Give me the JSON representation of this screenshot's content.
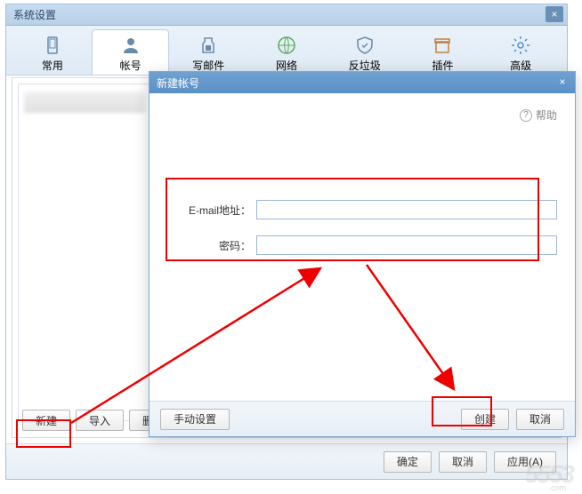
{
  "outer": {
    "title": "系统设置",
    "tabs": [
      {
        "label": "常用"
      },
      {
        "label": "帐号"
      },
      {
        "label": "写邮件"
      },
      {
        "label": "网络"
      },
      {
        "label": "反垃圾"
      },
      {
        "label": "插件"
      },
      {
        "label": "高级"
      }
    ],
    "active_tab": 1,
    "buttons": {
      "new": "新建",
      "import": "导入",
      "delete": "删除"
    },
    "footer": {
      "ok": "确定",
      "cancel": "取消",
      "apply": "应用(A)"
    }
  },
  "inner": {
    "title": "新建帐号",
    "help": "帮助",
    "email_label": "E-mail地址：",
    "password_label": "密码：",
    "manual": "手动设置",
    "create": "创建",
    "cancel": "取消"
  },
  "watermark": "5553",
  "watermark_sub": ".com"
}
